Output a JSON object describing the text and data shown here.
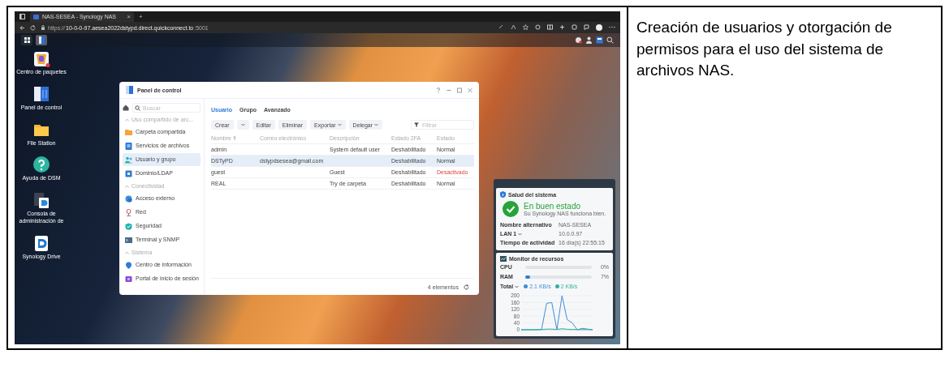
{
  "browser": {
    "tab_title": "NAS-SESEA - Synology NAS",
    "tab_close": "×",
    "new_tab": "+",
    "url_scheme": "https://",
    "url_host": "10-0-0-97.aesea2022dstypd.direct.quickconnect.to",
    "url_port": ":5001"
  },
  "desktop_icons": [
    {
      "label": "Centro de paquetes",
      "kind": "package"
    },
    {
      "label": "Panel de control",
      "kind": "control"
    },
    {
      "label": "File Station",
      "kind": "folder"
    },
    {
      "label": "Ayuda de DSM",
      "kind": "help"
    },
    {
      "label": "Consola de administración de",
      "kind": "console"
    },
    {
      "label": "Synology Drive",
      "kind": "drive"
    }
  ],
  "control_panel": {
    "title": "Panel de control",
    "search": {
      "placeholder": "Buscar"
    },
    "sidebar": [
      {
        "heading": "Uso compartido de arc...",
        "items": [
          {
            "label": "Carpeta compartida",
            "kind": "folder",
            "selected": false
          },
          {
            "label": "Servicios de archivos",
            "kind": "files",
            "selected": false
          },
          {
            "label": "Usuario y grupo",
            "kind": "users",
            "selected": true
          },
          {
            "label": "Dominio/LDAP",
            "kind": "domain",
            "selected": false
          }
        ]
      },
      {
        "heading": "Conectividad",
        "items": [
          {
            "label": "Acceso externo",
            "kind": "globe",
            "selected": false
          },
          {
            "label": "Red",
            "kind": "network",
            "selected": false
          },
          {
            "label": "Seguridad",
            "kind": "shield",
            "selected": false
          },
          {
            "label": "Terminal y SNMP",
            "kind": "terminal",
            "selected": false
          }
        ]
      },
      {
        "heading": "Sistema",
        "items": [
          {
            "label": "Centro de información",
            "kind": "info",
            "selected": false
          },
          {
            "label": "Portal de inicio de sesión",
            "kind": "portal",
            "selected": false
          }
        ]
      }
    ],
    "tabs": [
      {
        "label": "Usuario",
        "selected": true
      },
      {
        "label": "Grupo",
        "selected": false
      },
      {
        "label": "Avanzado",
        "selected": false
      }
    ],
    "toolbar": [
      {
        "label": "Crear",
        "kind": "split"
      },
      {
        "label": "Editar",
        "kind": "plain"
      },
      {
        "label": "Eliminar",
        "kind": "plain"
      },
      {
        "label": "Exportar",
        "kind": "menu"
      },
      {
        "label": "Delegar",
        "kind": "menu"
      }
    ],
    "filter": {
      "placeholder": "Filtrar"
    },
    "columns": [
      "Nombre",
      "Correo electrónico",
      "Descripción",
      "Estado 2FA",
      "Estado"
    ],
    "rows": [
      {
        "cells": [
          "admin",
          "",
          "System default user",
          "Deshabilitado",
          "Normal"
        ],
        "selected": false,
        "deactivated": false
      },
      {
        "cells": [
          "DSTyPD",
          "dstypdsesea@gmail.com",
          "",
          "Deshabilitado",
          "Normal"
        ],
        "selected": true,
        "deactivated": false
      },
      {
        "cells": [
          "guest",
          "",
          "Guest",
          "Deshabilitado",
          "Desactivado"
        ],
        "selected": false,
        "deactivated": true
      },
      {
        "cells": [
          "REAL",
          "",
          "Try de carpeta",
          "Deshabilitado",
          "Normal"
        ],
        "selected": false,
        "deactivated": false
      }
    ],
    "footer": "4 elementos"
  },
  "widget": {
    "health": {
      "title": "Salud del sistema",
      "status": "En buen estado",
      "message": "Su Synology NAS funciona bien.",
      "info": [
        {
          "label": "Nombre alternativo",
          "value": "NAS-SESEA",
          "dropdown": false
        },
        {
          "label": "LAN 1",
          "value": "10.0.0.97",
          "dropdown": true
        },
        {
          "label": "Tiempo de actividad",
          "value": "16 día(s) 22:55:15",
          "dropdown": false
        }
      ]
    },
    "monitor": {
      "title": "Monitor de recursos",
      "meters": [
        {
          "label": "CPU",
          "level": 0,
          "reading": "0%"
        },
        {
          "label": "RAM",
          "level": 0.07,
          "reading": "7%"
        }
      ],
      "total_label": "Total",
      "chart_data": {
        "type": "line",
        "grid": true,
        "ylim": [
          0,
          200
        ],
        "yticks": [
          0,
          40,
          80,
          120,
          160,
          200
        ],
        "series": [
          {
            "name": "2.1 KB/s",
            "color": "#3d8fd9",
            "values": [
              0,
              0,
              0,
              0,
              2,
              155,
              160,
              0,
              200,
              60,
              40,
              0,
              8,
              4,
              0
            ]
          },
          {
            "name": "2 KB/s",
            "color": "#2fb39a",
            "values": [
              0,
              0,
              0,
              0,
              1,
              4,
              4,
              2,
              6,
              3,
              2,
              1,
              1,
              1,
              0
            ]
          }
        ]
      }
    }
  },
  "document": {
    "description": "Creación de usuarios y otorgación de permisos para el uso del sistema de archivos NAS."
  }
}
